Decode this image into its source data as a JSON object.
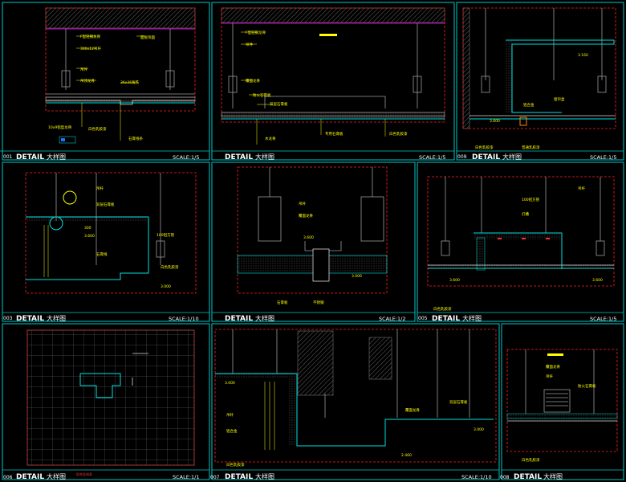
{
  "drawing": {
    "panels": [
      {
        "id": "001",
        "title": "DETAIL",
        "cn": "大样图",
        "scale": "SCALE:1/5",
        "notes": [
          "F型轻钢龙骨",
          "300x12吊杆",
          "吊件",
          "吊顶龙骨",
          "面板饰面",
          "36x36角铁",
          "10x9铝型龙骨",
          "白色乳胶漆",
          "石膏线条"
        ]
      },
      {
        "id": "002",
        "title": "DETAIL",
        "cn": "大样图",
        "scale": "SCALE:1/5",
        "notes": [
          "F型轻钢龙骨",
          "吊件",
          "覆面龙骨",
          "防火石膏板",
          "双层石膏板",
          "木龙骨",
          "专用石膏板",
          "白色乳胶漆"
        ]
      },
      {
        "id": "009",
        "title": "DETAIL",
        "cn": "大样图",
        "scale": "SCALE:1/5",
        "notes": [
          "3.160",
          "3.600",
          "窗帘盒",
          "铝合金",
          "白色乳胶漆",
          "普通乳胶漆"
        ]
      },
      {
        "id": "003",
        "title": "DETAIL",
        "cn": "大样图",
        "scale": "SCALE:1/10",
        "notes": [
          "300",
          "3.600",
          "3.000",
          "吊杆",
          "双层石膏板",
          "100铝方管",
          "白色乳胶漆",
          "石膏线"
        ]
      },
      {
        "id": "004",
        "title": "DETAIL",
        "cn": "大样图",
        "scale": "SCALE:1/2",
        "notes": [
          "3.600",
          "3.000",
          "吊杆",
          "覆面龙骨",
          "石膏板",
          "不锈钢"
        ]
      },
      {
        "id": "005",
        "title": "DETAIL",
        "cn": "大样图",
        "scale": "SCALE:1/5",
        "notes": [
          "3.600",
          "3.600",
          "100铝方管",
          "吊杆",
          "白色乳胶漆",
          "灯槽"
        ]
      },
      {
        "id": "006",
        "title": "DETAIL",
        "cn": "大样图",
        "scale": "SCALE:1/1",
        "notes": [
          "铝合金线条"
        ]
      },
      {
        "id": "007",
        "title": "DETAIL",
        "cn": "大样图",
        "scale": "SCALE:1/10",
        "notes": [
          "2.460",
          "3.000",
          "3.000",
          "吊杆",
          "铝合金",
          "覆面龙骨",
          "双层石膏板",
          "白色乳胶漆"
        ]
      },
      {
        "id": "008",
        "title": "DETAIL",
        "cn": "大样图",
        "scale": "SCALE:1/5",
        "notes": [
          "覆面龙骨",
          "吊杆",
          "防火石膏板",
          "白色乳胶漆"
        ]
      }
    ]
  },
  "colors": {
    "frame": "#00c8c8",
    "red": "#ff2020",
    "yellow": "#ffff00",
    "magenta": "#d000d0",
    "blue": "#2a6cff"
  }
}
